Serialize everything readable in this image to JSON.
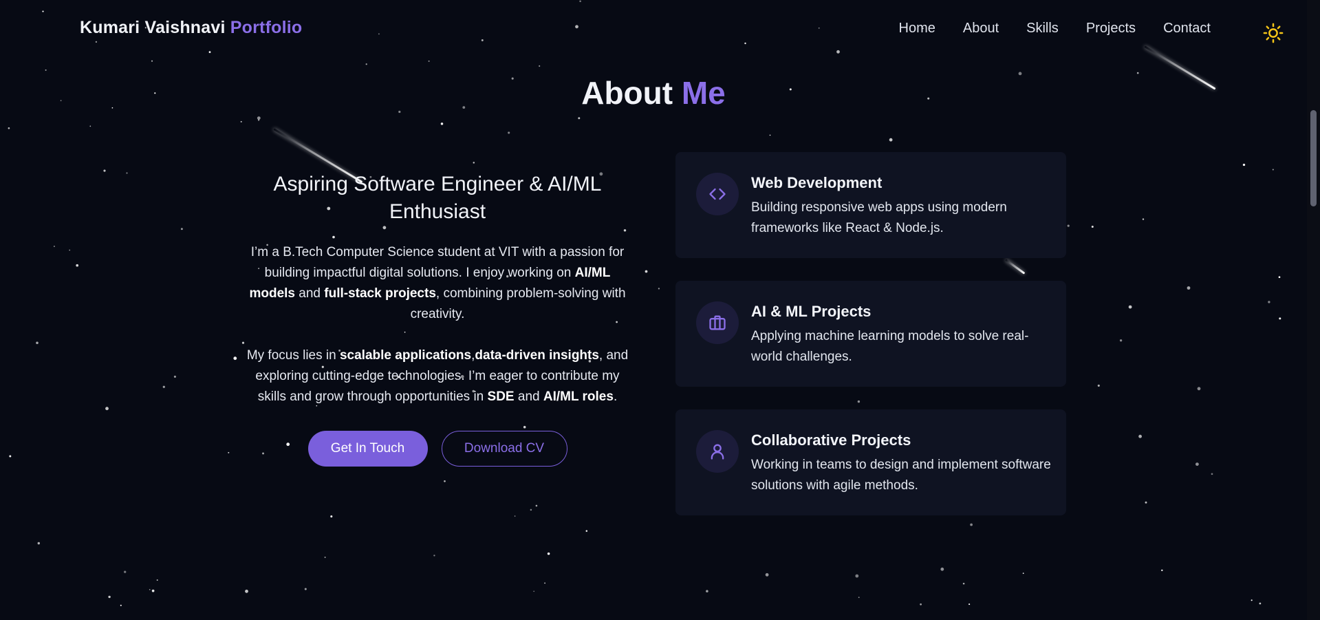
{
  "header": {
    "brand_name": "Kumari Vaishnavi",
    "brand_accent": "Portfolio",
    "nav": [
      {
        "label": "Home"
      },
      {
        "label": "About"
      },
      {
        "label": "Skills"
      },
      {
        "label": "Projects"
      },
      {
        "label": "Contact"
      }
    ],
    "theme_toggle_icon": "sun-icon"
  },
  "about": {
    "title_main": "About",
    "title_accent": "Me",
    "heading": "Aspiring Software Engineer & AI/ML Enthusiast",
    "para1": {
      "t1": "I’m a B.Tech Computer Science student at VIT with a passion for building impactful digital solutions. I enjoy working on ",
      "b1": "AI/ML models",
      "t2": " and ",
      "b2": "full-stack projects",
      "t3": ", combining problem-solving with creativity."
    },
    "para2": {
      "t1": "My focus lies in ",
      "b1": "scalable applications",
      "t2": ",",
      "b2": "data-driven insights",
      "t3": ", and exploring cutting-edge technologies. I’m eager to contribute my skills and grow through opportunities in ",
      "b3": "SDE",
      "t4": " and ",
      "b4": "AI/ML roles",
      "t5": "."
    },
    "buttons": {
      "primary": "Get In Touch",
      "secondary": "Download CV"
    }
  },
  "cards": [
    {
      "icon": "code-icon",
      "title": "Web Development",
      "desc": "Building responsive web apps using modern frameworks like React & Node.js."
    },
    {
      "icon": "briefcase-icon",
      "title": "AI & ML Projects",
      "desc": "Applying machine learning models to solve real-world challenges."
    },
    {
      "icon": "user-icon",
      "title": "Collaborative Projects",
      "desc": "Working in teams to design and implement software solutions with agile methods."
    }
  ],
  "colors": {
    "background": "#070a14",
    "accent": "#8b6fe8",
    "card_bg": "#0f1322",
    "sun": "#f5c518"
  }
}
